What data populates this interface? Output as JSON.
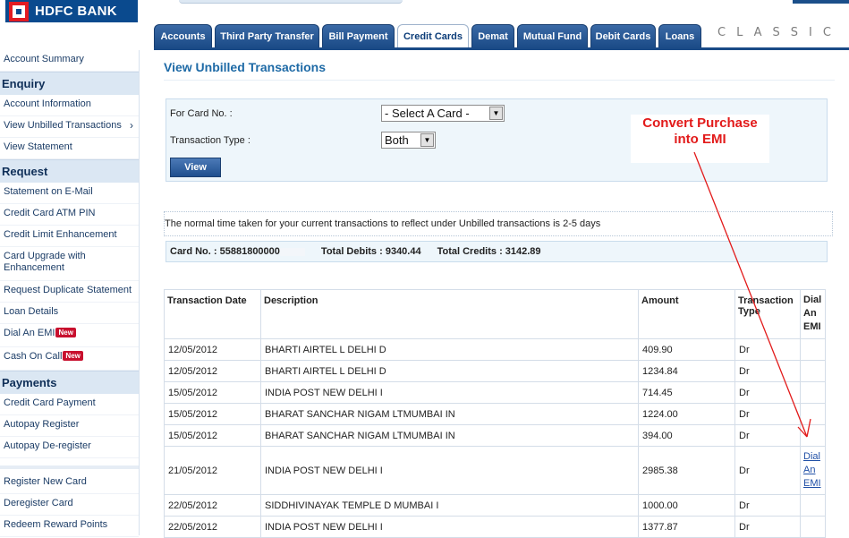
{
  "header": {
    "bank_name": "HDFC BANK",
    "classic_label": "CLASSIC",
    "tabs": [
      {
        "label": "Accounts"
      },
      {
        "label": "Third Party Transfer"
      },
      {
        "label": "Bill Payment"
      },
      {
        "label": "Credit Cards"
      },
      {
        "label": "Demat"
      },
      {
        "label": "Mutual Fund"
      },
      {
        "label": "Debit Cards"
      },
      {
        "label": "Loans"
      }
    ],
    "active_tab": "Credit Cards"
  },
  "sidebar": {
    "account_summary": "Account Summary",
    "enquiry": {
      "heading": "Enquiry",
      "items": [
        "Account Information",
        "View Unbilled Transactions",
        "View Statement"
      ]
    },
    "request": {
      "heading": "Request",
      "items": [
        "Statement on E-Mail",
        "Credit Card ATM PIN",
        "Credit Limit Enhancement",
        "Card Upgrade with Enhancement",
        "Request Duplicate Statement",
        "Loan Details",
        "Dial An EMI",
        "Cash On Call"
      ],
      "new_badge": "New"
    },
    "payments": {
      "heading": "Payments",
      "items": [
        "Credit Card Payment",
        "Autopay Register",
        "Autopay De-register"
      ]
    },
    "other_items": [
      "Register New Card",
      "Deregister Card",
      "Redeem Reward Points"
    ]
  },
  "main": {
    "title": "View Unbilled Transactions",
    "filter": {
      "card_label": "For Card No. :",
      "card_select": "- Select A Card -",
      "type_label": "Transaction Type :",
      "type_select": "Both",
      "view_button": "View"
    },
    "annotation": {
      "line1": "Convert Purchase",
      "line2": "into EMI"
    },
    "info_text": "The normal time taken for your current transactions to reflect under Unbilled transactions is 2-5 days",
    "summary": {
      "card_no": "Card No. : 55881800000",
      "total_debits": "Total Debits : 9340.44",
      "total_credits": "Total Credits : 3142.89"
    },
    "table": {
      "headers": {
        "date": "Transaction Date",
        "description": "Description",
        "amount": "Amount",
        "type_line1": "Transaction",
        "type_line2": "Type",
        "emi_line1": "Dial",
        "emi_line2": "An",
        "emi_line3": "EMI"
      },
      "rows": [
        {
          "date": "12/05/2012",
          "description": "BHARTI AIRTEL L DELHI D",
          "amount": "409.90",
          "type": "Dr"
        },
        {
          "date": "12/05/2012",
          "description": "BHARTI AIRTEL L DELHI D",
          "amount": "1234.84",
          "type": "Dr"
        },
        {
          "date": "15/05/2012",
          "description": "INDIA POST NEW DELHI I",
          "amount": "714.45",
          "type": "Dr"
        },
        {
          "date": "15/05/2012",
          "description": "BHARAT SANCHAR NIGAM LTMUMBAI IN",
          "amount": "1224.00",
          "type": "Dr"
        },
        {
          "date": "15/05/2012",
          "description": "BHARAT SANCHAR NIGAM LTMUMBAI IN",
          "amount": "394.00",
          "type": "Dr"
        },
        {
          "date": "21/05/2012",
          "description": "INDIA POST NEW DELHI I",
          "amount": "2985.38",
          "type": "Dr",
          "emi_link": {
            "line1": "Dial",
            "line2": "An",
            "line3": "EMI"
          }
        },
        {
          "date": "22/05/2012",
          "description": "SIDDHIVINAYAK TEMPLE D MUMBAI I",
          "amount": "1000.00",
          "type": "Dr"
        },
        {
          "date": "22/05/2012",
          "description": "INDIA POST NEW DELHI I",
          "amount": "1377.87",
          "type": "Dr"
        }
      ]
    }
  },
  "colors": {
    "brand_blue": "#0a4a8e",
    "brand_red": "#e21b22",
    "tab_blue": "#1a4a86",
    "title_blue": "#1e6aa6",
    "annotation_red": "#e21a1a",
    "panel_bg": "#eef6fb"
  }
}
